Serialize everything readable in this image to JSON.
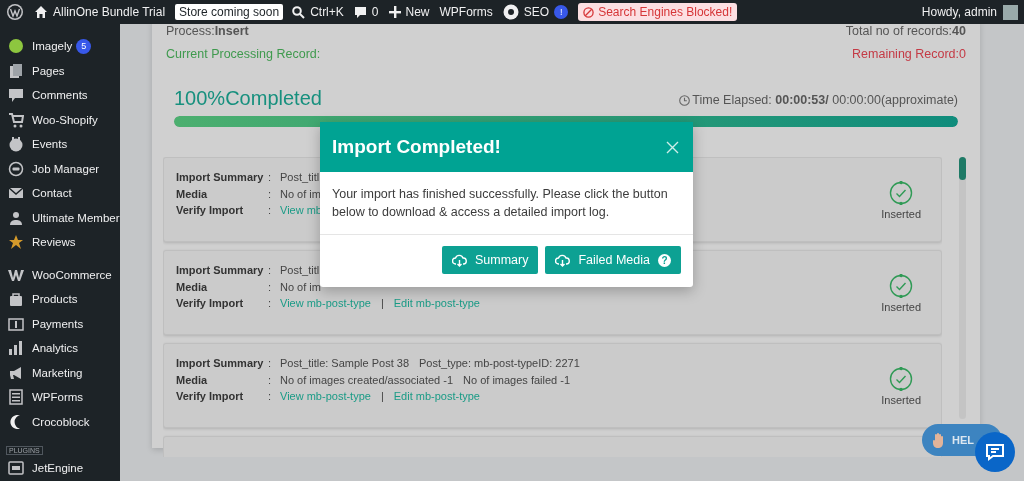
{
  "admin_bar": {
    "site": "AllinOne Bundle Trial",
    "store_badge": "Store coming soon",
    "search": "Ctrl+K",
    "comments": "0",
    "new": "New",
    "wpforms": "WPForms",
    "seo": "SEO",
    "seo_badge": "!",
    "alert": "Search Engines Blocked!",
    "greeting": "Howdy, admin"
  },
  "sidebar": {
    "groups": [
      {
        "items": [
          {
            "label": "Imagely",
            "badge": "5"
          },
          {
            "label": "Pages"
          },
          {
            "label": "Comments"
          },
          {
            "label": "Woo-Shopify"
          },
          {
            "label": "Events"
          },
          {
            "label": "Job Manager"
          },
          {
            "label": "Contact"
          },
          {
            "label": "Ultimate Member"
          },
          {
            "label": "Reviews"
          }
        ]
      },
      {
        "items": [
          {
            "label": "WooCommerce"
          },
          {
            "label": "Products"
          },
          {
            "label": "Payments"
          },
          {
            "label": "Analytics"
          },
          {
            "label": "Marketing"
          },
          {
            "label": "WPForms"
          },
          {
            "label": "Crocoblock"
          }
        ]
      },
      {
        "heading": "PLUGINS",
        "items": [
          {
            "label": "JetEngine"
          }
        ]
      }
    ]
  },
  "status": {
    "process": "Process:**Insert**",
    "total": "Total no of records:**40**",
    "current": "Current Processing Record:",
    "remaining": "Remaining Record:0"
  },
  "progress": {
    "label": "100%Completed",
    "time": "Time Elapsed: **00:00:53/** 00:00:00(approximate)",
    "level": 1
  },
  "records": [
    {
      "rows": [
        {
          "kind": "text",
          "label": "Import Summary",
          "colon": ":",
          "values": [
            "Post_titl"
          ]
        },
        {
          "kind": "text",
          "label": "Media",
          "colon": ":",
          "values": [
            "No of im"
          ]
        },
        {
          "kind": "links",
          "label": "Verify Import",
          "colon": ":",
          "links": [
            "View mb"
          ]
        }
      ],
      "status": "Inserted"
    },
    {
      "rows": [
        {
          "kind": "text",
          "label": "Import Summary",
          "colon": ":",
          "values": [
            "Post_titl"
          ]
        },
        {
          "kind": "text",
          "label": "Media",
          "colon": ":",
          "values": [
            "No of im"
          ]
        },
        {
          "kind": "links",
          "label": "Verify Import",
          "colon": ":",
          "links": [
            "View mb-post-type",
            "Edit mb-post-type"
          ],
          "divider": "|"
        }
      ],
      "status": "Inserted"
    },
    {
      "rows": [
        {
          "kind": "text",
          "label": "Import Summary",
          "colon": ":",
          "values": [
            "Post_title: Sample Post 38",
            "Post_type: mb-post-typeID: 2271"
          ]
        },
        {
          "kind": "text",
          "label": "Media",
          "colon": ":",
          "values": [
            "No of images created/associated -1",
            "No of images failed -1"
          ]
        },
        {
          "kind": "links",
          "label": "Verify Import",
          "colon": ":",
          "links": [
            "View mb-post-type",
            "Edit mb-post-type"
          ],
          "divider": "|"
        }
      ],
      "status": "Inserted"
    }
  ],
  "modal": {
    "title": "Import Completed!",
    "message": "Your import has finished successfully. Please click the button below to download & access a detailed import log.",
    "buttons": [
      {
        "label": "Summary"
      },
      {
        "label": "Failed Media",
        "badge": "?"
      }
    ]
  },
  "help": {
    "label": "HEL"
  }
}
